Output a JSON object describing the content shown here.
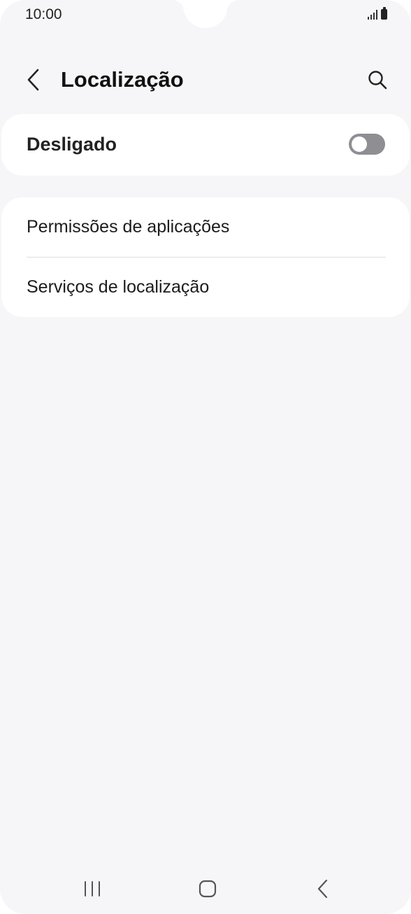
{
  "status_bar": {
    "time": "10:00",
    "icons": [
      "signal-icon",
      "battery-icon"
    ]
  },
  "header": {
    "title": "Localização",
    "back_icon": "chevron-left-icon",
    "search_icon": "search-icon"
  },
  "location_toggle": {
    "label": "Desligado",
    "state": "off"
  },
  "settings_list": {
    "items": [
      {
        "label": "Permissões de aplicações"
      },
      {
        "label": "Serviços de localização"
      }
    ]
  },
  "nav_bar": {
    "icons": [
      "recents-icon",
      "home-icon",
      "back-icon"
    ]
  },
  "colors": {
    "background": "#f6f6f8",
    "card": "#ffffff",
    "switch_off": "#8e8e93",
    "text": "#1c1c1c"
  }
}
